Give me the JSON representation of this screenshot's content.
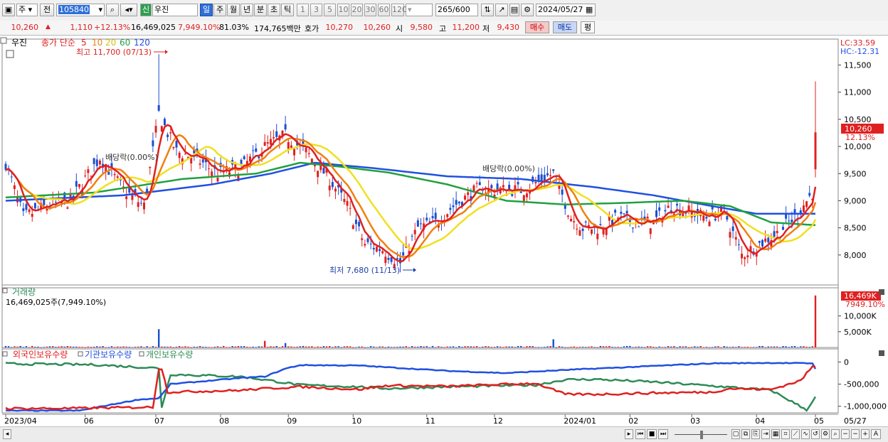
{
  "toolbar": {
    "market_label": "주",
    "prev_label": "전",
    "code_value": "105840",
    "badge_label": "신",
    "name_value": "우진",
    "periods": [
      "일",
      "주",
      "월",
      "년",
      "분",
      "초",
      "틱"
    ],
    "selected_period": "일",
    "intervals": [
      "1",
      "3",
      "5",
      "10",
      "20",
      "30",
      "60",
      "120"
    ],
    "count_value": "265",
    "count_total": "/600",
    "date_value": "2024/05/27"
  },
  "quote": {
    "price": "10,260",
    "change": "1,110",
    "change_pct": "+12.13%",
    "volume": "16,469,025",
    "volume_pct": "7,949.10%",
    "ratio": "81.03%",
    "amount": "174,765백만",
    "bid_label": "호가",
    "bid1": "10,270",
    "bid2": "10,260",
    "open_label": "시",
    "open": "9,580",
    "high_label": "고",
    "high": "11,200",
    "low_label": "저",
    "low": "9,430",
    "buy_label": "매수",
    "sell_label": "매도",
    "eval_label": "평"
  },
  "colors": {
    "ma5": "#e02020",
    "ma10": "#f08010",
    "ma20": "#f0e020",
    "ma60": "#20a040",
    "ma120": "#2050e0",
    "up": "#e02020",
    "down": "#1a4fd0",
    "foreign": "#e02020",
    "inst": "#2050e0",
    "indiv": "#2e8b57"
  },
  "chart_data": [
    {
      "type": "candlestick",
      "title": "우진",
      "legend_prefix": "종가 단순",
      "legend": [
        "5",
        "10",
        "20",
        "60",
        "120"
      ],
      "lc_label": "LC:33.59",
      "hc_label": "HC:-12.31",
      "ylim": [
        7500,
        11900
      ],
      "yticks": [
        "11,500",
        "11,000",
        "10,500",
        "10,000",
        "9,500",
        "9,000",
        "8,500",
        "8,000"
      ],
      "yvalues": [
        11500,
        11000,
        10500,
        10000,
        9500,
        9000,
        8500,
        8000
      ],
      "last_price_label": "10,260",
      "last_pct_label": "12.13%",
      "annotations": {
        "high": "최고 11,700 (07/13)",
        "low": "최저 7,680 (11/13)",
        "dividend1": "배당락(0.00%)",
        "dividend2": "배당락(0.00%)"
      },
      "close_anchors": [
        [
          0,
          9700
        ],
        [
          6,
          8700
        ],
        [
          14,
          8900
        ],
        [
          22,
          9000
        ],
        [
          32,
          9800
        ],
        [
          40,
          9200
        ],
        [
          47,
          8900
        ],
        [
          52,
          10600
        ],
        [
          58,
          9900
        ],
        [
          64,
          9800
        ],
        [
          72,
          9500
        ],
        [
          80,
          9600
        ],
        [
          88,
          10000
        ],
        [
          95,
          10200
        ],
        [
          102,
          9900
        ],
        [
          110,
          9400
        ],
        [
          116,
          8900
        ],
        [
          122,
          8200
        ],
        [
          128,
          8100
        ],
        [
          134,
          7850
        ],
        [
          140,
          8500
        ],
        [
          146,
          8600
        ],
        [
          152,
          8900
        ],
        [
          160,
          9200
        ],
        [
          168,
          9200
        ],
        [
          176,
          9200
        ],
        [
          182,
          9400
        ],
        [
          186,
          9500
        ],
        [
          192,
          8700
        ],
        [
          196,
          8500
        ],
        [
          202,
          8500
        ],
        [
          208,
          8700
        ],
        [
          214,
          8600
        ],
        [
          220,
          8600
        ],
        [
          226,
          8900
        ],
        [
          232,
          8800
        ],
        [
          238,
          8700
        ],
        [
          244,
          8800
        ],
        [
          250,
          8000
        ],
        [
          256,
          8200
        ],
        [
          262,
          8400
        ],
        [
          268,
          8700
        ],
        [
          274,
          9150
        ],
        [
          275,
          10260
        ]
      ],
      "ma60_anchors": [
        [
          0,
          9060
        ],
        [
          30,
          9150
        ],
        [
          60,
          9400
        ],
        [
          85,
          9500
        ],
        [
          100,
          9700
        ],
        [
          115,
          9620
        ],
        [
          130,
          9520
        ],
        [
          150,
          9300
        ],
        [
          170,
          9000
        ],
        [
          190,
          8930
        ],
        [
          210,
          8960
        ],
        [
          230,
          9000
        ],
        [
          246,
          8900
        ],
        [
          260,
          8600
        ],
        [
          275,
          8550
        ]
      ],
      "ma120_anchors": [
        [
          0,
          9000
        ],
        [
          40,
          9100
        ],
        [
          70,
          9300
        ],
        [
          90,
          9500
        ],
        [
          105,
          9700
        ],
        [
          125,
          9600
        ],
        [
          150,
          9450
        ],
        [
          175,
          9400
        ],
        [
          200,
          9250
        ],
        [
          220,
          9100
        ],
        [
          240,
          8900
        ],
        [
          255,
          8760
        ],
        [
          275,
          8760
        ]
      ]
    },
    {
      "type": "bar",
      "title": "거래량",
      "value_label": "16,469,025주(7,949.10%)",
      "last_label": "16,469K",
      "last_pct": "7949.10%",
      "ylim": [
        0,
        18000
      ],
      "yticks": [
        "10,000K",
        "5,000K"
      ],
      "yvalues": [
        10000,
        5000
      ],
      "spikes": [
        [
          52,
          5800
        ],
        [
          88,
          2100
        ],
        [
          95,
          1400
        ],
        [
          186,
          2600
        ],
        [
          275,
          16469
        ]
      ]
    },
    {
      "type": "line",
      "legend": [
        "외국인보유수량",
        "기관보유수량",
        "개인보유수량"
      ],
      "ylim": [
        -1150000,
        200000
      ],
      "yticks": [
        "0",
        "-500,000",
        "-1,000,000"
      ],
      "yvalues": [
        0,
        -500000,
        -1000000
      ],
      "foreign_anchors": [
        [
          0,
          -1050000
        ],
        [
          20,
          -1050000
        ],
        [
          40,
          -1030000
        ],
        [
          50,
          -1020000
        ],
        [
          52,
          -150000
        ],
        [
          53,
          -150000
        ],
        [
          55,
          -680000
        ],
        [
          80,
          -640000
        ],
        [
          88,
          -600000
        ],
        [
          100,
          -560000
        ],
        [
          120,
          -620000
        ],
        [
          130,
          -530000
        ],
        [
          150,
          -550000
        ],
        [
          180,
          -480000
        ],
        [
          190,
          -730000
        ],
        [
          200,
          -730000
        ],
        [
          220,
          -700000
        ],
        [
          240,
          -680000
        ],
        [
          246,
          -600000
        ],
        [
          260,
          -620000
        ],
        [
          270,
          -420000
        ],
        [
          274,
          -100000
        ],
        [
          275,
          -120000
        ]
      ],
      "inst_anchors": [
        [
          0,
          -1100000
        ],
        [
          25,
          -1100000
        ],
        [
          45,
          -850000
        ],
        [
          52,
          -820000
        ],
        [
          56,
          -500000
        ],
        [
          80,
          -360000
        ],
        [
          88,
          -330000
        ],
        [
          95,
          -150000
        ],
        [
          100,
          -70000
        ],
        [
          120,
          -80000
        ],
        [
          150,
          -200000
        ],
        [
          170,
          -250000
        ],
        [
          190,
          -180000
        ],
        [
          210,
          -120000
        ],
        [
          240,
          -30000
        ],
        [
          260,
          -20000
        ],
        [
          274,
          -30000
        ],
        [
          275,
          -150000
        ]
      ],
      "indiv_anchors": [
        [
          0,
          -40000
        ],
        [
          30,
          -60000
        ],
        [
          52,
          -140000
        ],
        [
          53,
          -1020000
        ],
        [
          56,
          -280000
        ],
        [
          80,
          -330000
        ],
        [
          90,
          -420000
        ],
        [
          100,
          -520000
        ],
        [
          120,
          -560000
        ],
        [
          130,
          -600000
        ],
        [
          150,
          -560000
        ],
        [
          180,
          -520000
        ],
        [
          190,
          -400000
        ],
        [
          200,
          -390000
        ],
        [
          220,
          -450000
        ],
        [
          240,
          -540000
        ],
        [
          260,
          -640000
        ],
        [
          272,
          -1080000
        ],
        [
          275,
          -800000
        ]
      ]
    }
  ],
  "xaxis": {
    "labels": [
      "2023/04",
      "06",
      "07",
      "08",
      "09",
      "10",
      "11",
      "12",
      "2024/01",
      "02",
      "03",
      "04",
      "05",
      "05/27"
    ]
  }
}
